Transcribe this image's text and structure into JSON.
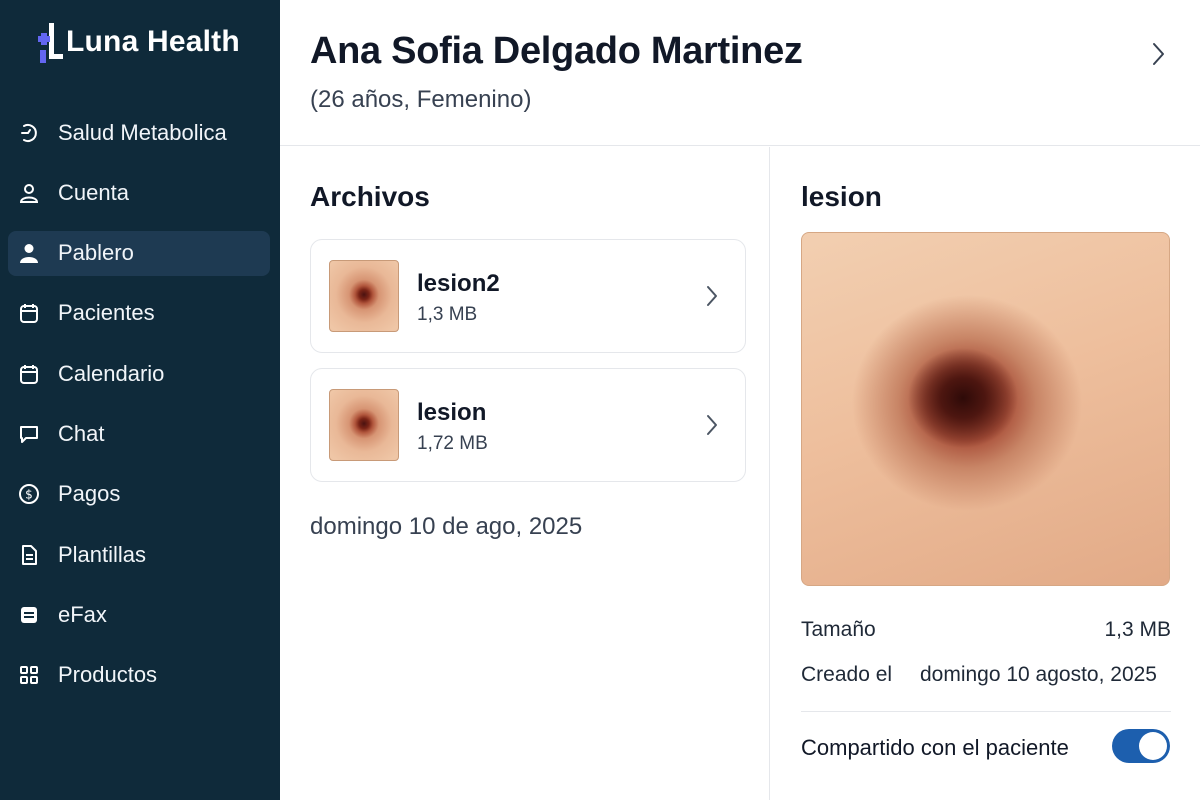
{
  "app": {
    "brand": "Luna Health",
    "accent_color": "#6366f1",
    "sidebar_color": "#0f2a3a"
  },
  "sidebar": {
    "items": [
      {
        "label": "Salud Metabolica",
        "icon": "metabolic-icon",
        "active": false
      },
      {
        "label": "Cuenta",
        "icon": "user-outline-icon",
        "active": false
      },
      {
        "label": "Pablero",
        "icon": "user-filled-icon",
        "active": true
      },
      {
        "label": "Pacientes",
        "icon": "clipboard-icon",
        "active": false
      },
      {
        "label": "Calendario",
        "icon": "calendar-icon",
        "active": false
      },
      {
        "label": "Chat",
        "icon": "chat-bubble-icon",
        "active": false
      },
      {
        "label": "Pagos",
        "icon": "dollar-circle-icon",
        "active": false
      },
      {
        "label": "Plantillas",
        "icon": "document-icon",
        "active": false
      },
      {
        "label": "eFax",
        "icon": "fax-icon",
        "active": false
      },
      {
        "label": "Productos",
        "icon": "grid-icon",
        "active": false
      }
    ]
  },
  "header": {
    "patient_name": "Ana Sofia Delgado Martinez",
    "patient_sub": "(26 años, Femenino)"
  },
  "files": {
    "title": "Archivos",
    "items": [
      {
        "name": "lesion2",
        "size": "1,3 MB"
      },
      {
        "name": "lesion",
        "size": "1,72 MB"
      }
    ],
    "date": "domingo 10 de ago, 2025"
  },
  "detail": {
    "title": "lesion",
    "size_label": "Tamaño",
    "size_value": "1,3 MB",
    "created_label": "Creado el",
    "created_value": "domingo 10 agosto, 2025",
    "shared_label": "Compartido con el paciente",
    "shared_enabled": true,
    "toggle_color": "#1d5fae"
  }
}
